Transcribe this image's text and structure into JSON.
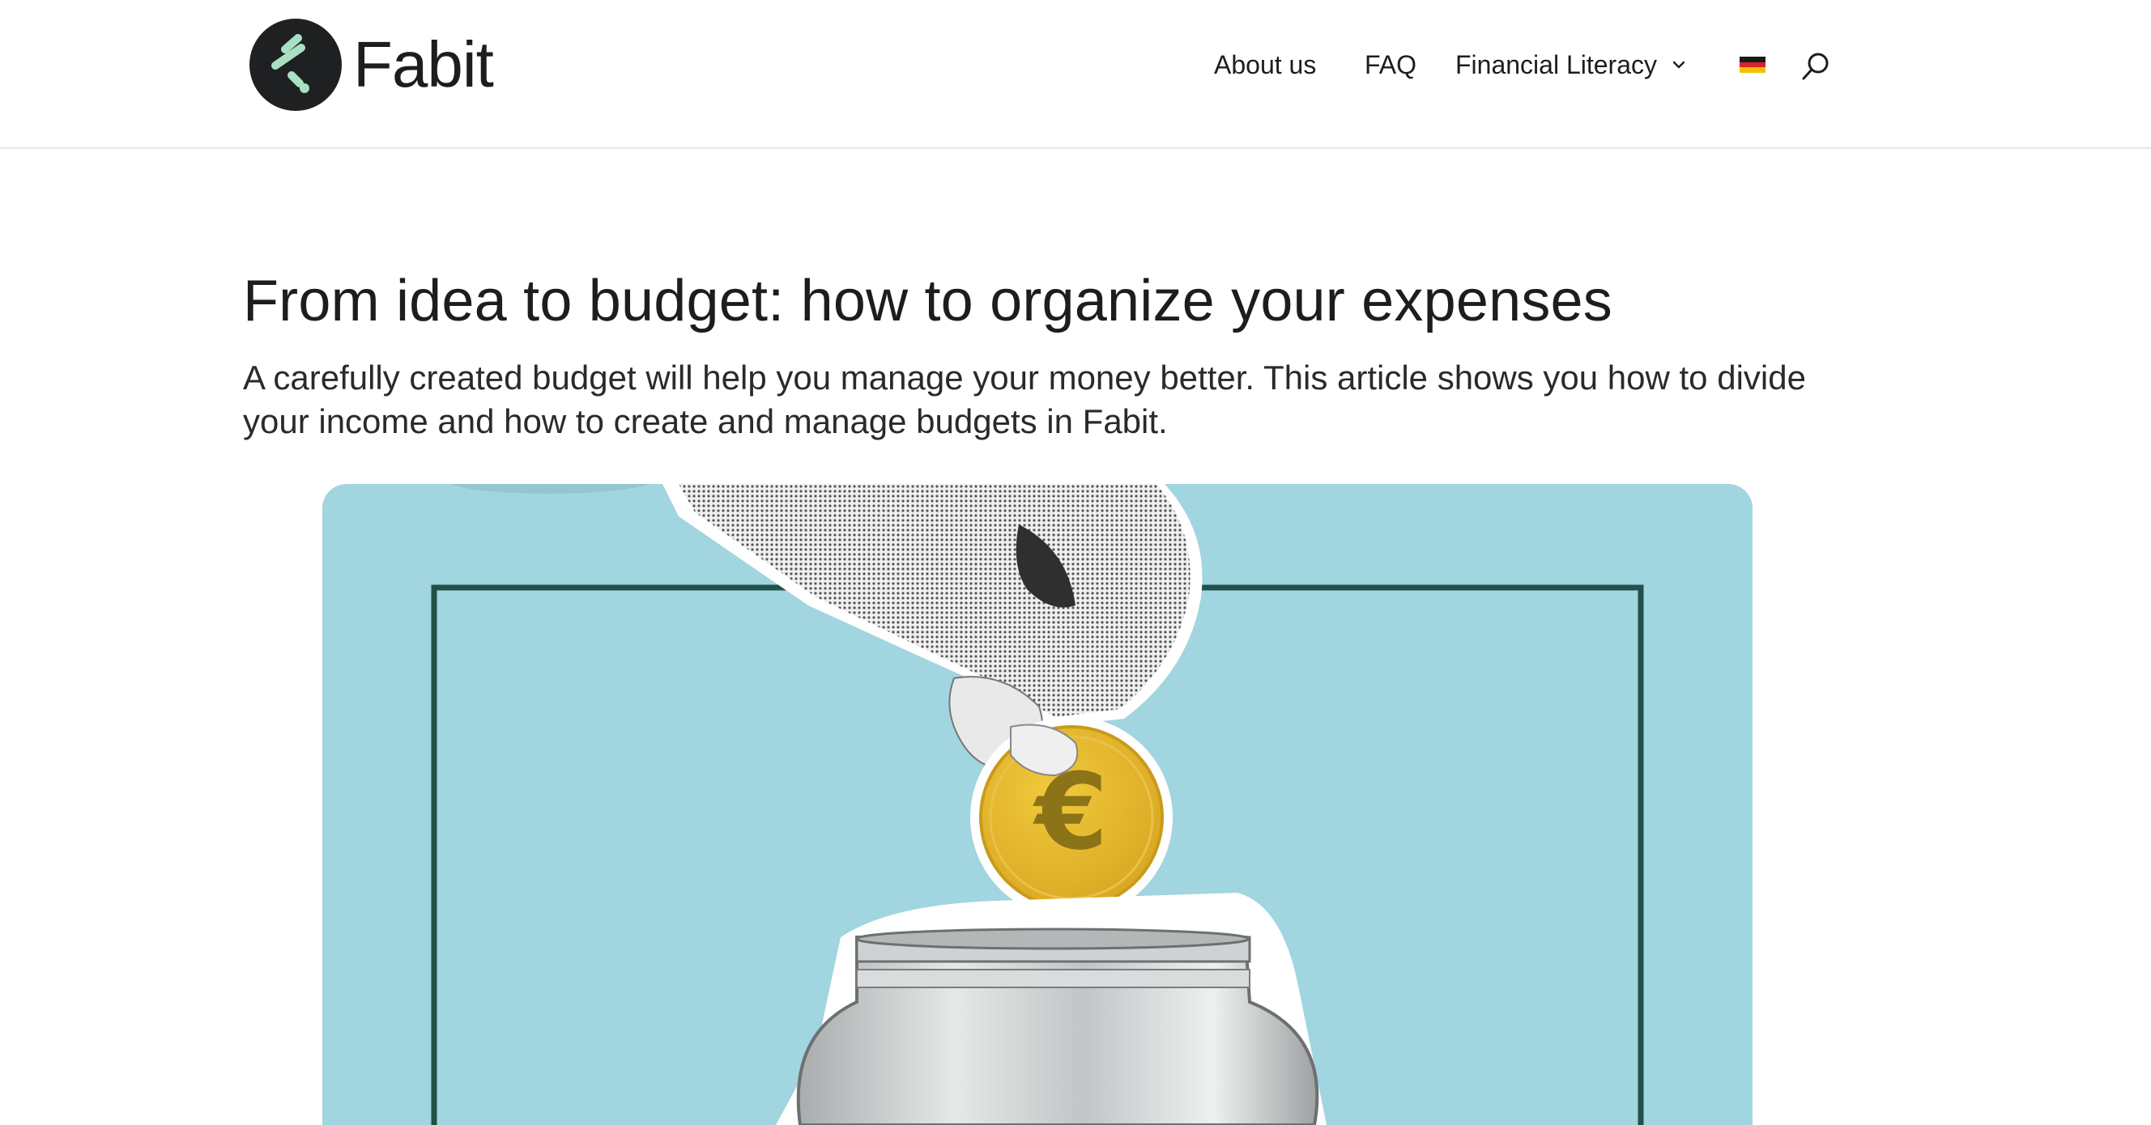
{
  "brand": {
    "name": "Fabit",
    "accent_color": "#a8e0c4",
    "logo_bg": "#1f2021"
  },
  "nav": {
    "items": [
      {
        "label": "About us"
      },
      {
        "label": "FAQ"
      },
      {
        "label": "Financial Literacy",
        "icon": "chevron-down-icon"
      }
    ],
    "language_icon": "german-flag-icon",
    "search_icon": "search-icon"
  },
  "article": {
    "title": "From idea to budget: how to organize your expenses",
    "lead": "A carefully created budget will help you manage your money better. This article shows you how to divide your income and how to create and manage budgets in Fabit.",
    "hero_image": {
      "background_color": "#a1d5df",
      "frame_color": "#22504a",
      "coin_color": "#e3b42a",
      "coin_symbol": "€"
    }
  }
}
